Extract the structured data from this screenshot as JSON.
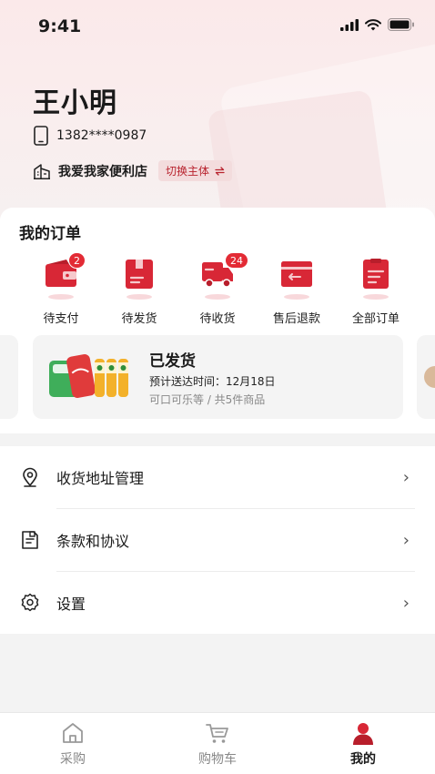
{
  "status_bar": {
    "time": "9:41"
  },
  "profile": {
    "name": "王小明",
    "phone": "1382****0987",
    "store": "我爱我家便利店",
    "switch_label": "切换主体"
  },
  "orders": {
    "title": "我的订单",
    "items": [
      {
        "label": "待支付",
        "badge": "2",
        "icon": "wallet-icon"
      },
      {
        "label": "待发货",
        "badge": "",
        "icon": "package-icon"
      },
      {
        "label": "待收货",
        "badge": "24",
        "icon": "truck-icon"
      },
      {
        "label": "售后退款",
        "badge": "",
        "icon": "refund-icon"
      },
      {
        "label": "全部订单",
        "badge": "",
        "icon": "orders-list-icon"
      }
    ]
  },
  "shipment": {
    "status": "已发货",
    "eta": "预计送达时间：12月18日",
    "items": "可口可乐等 / 共5件商品"
  },
  "menu": {
    "items": [
      {
        "label": "收货地址管理",
        "icon": "location-pin-icon"
      },
      {
        "label": "条款和协议",
        "icon": "document-icon"
      },
      {
        "label": "设置",
        "icon": "gear-icon"
      }
    ]
  },
  "tabs": [
    {
      "label": "采购",
      "icon": "home-icon",
      "active": false
    },
    {
      "label": "购物车",
      "icon": "cart-icon",
      "active": false
    },
    {
      "label": "我的",
      "icon": "user-icon",
      "active": true
    }
  ],
  "colors": {
    "accent": "#d82736",
    "badge": "#e32b35"
  }
}
